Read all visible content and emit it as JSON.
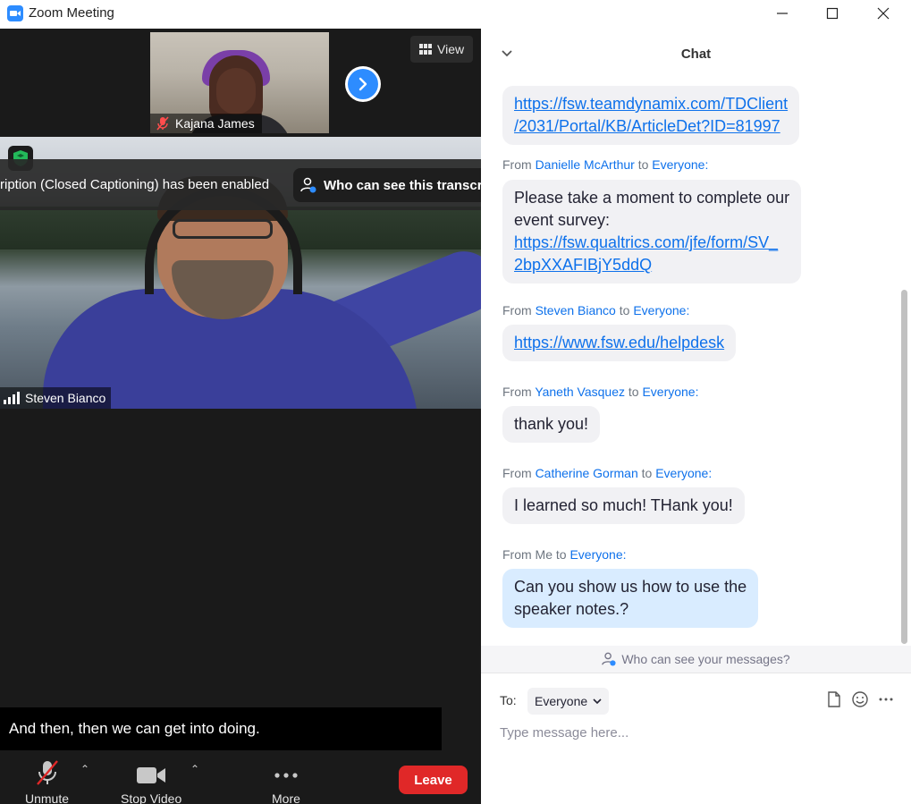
{
  "window": {
    "title": "Zoom Meeting",
    "controls": [
      "minimize-icon",
      "maximize-icon",
      "close-icon"
    ]
  },
  "gallery": {
    "view_label": "View",
    "thumbnail_name": "Kajana James",
    "main_speaker_name": "Steven Bianco"
  },
  "caption_notice": {
    "message": "ription (Closed Captioning) has been enabled",
    "who_can_see": "Who can see this transcript?",
    "close": "✕"
  },
  "live_caption": "And then, then we can get into doing.",
  "toolbar": {
    "unmute": "Unmute",
    "stop_video": "Stop Video",
    "more": "More",
    "leave": "Leave"
  },
  "chat": {
    "title": "Chat",
    "messages": [
      {
        "from_prefix": "",
        "from": "",
        "to_prefix": "",
        "to": "",
        "lines": [
          "https://fsw.teamdynamix.com/TDClient",
          "/2031/Portal/KB/ArticleDet?ID=81997"
        ]
      },
      {
        "from_prefix": "From",
        "from": "Danielle McArthur",
        "to_prefix": "to",
        "to": "Everyone:",
        "text_lines": [
          "Please take a moment to complete our",
          "event survey:"
        ],
        "link_lines": [
          "https://fsw.qualtrics.com/jfe/form/SV_",
          "2bpXXAFIBjY5ddQ"
        ]
      },
      {
        "from_prefix": "From",
        "from": "Steven Bianco",
        "to_prefix": "to",
        "to": "Everyone:",
        "link": "https://www.fsw.edu/helpdesk"
      },
      {
        "from_prefix": "From",
        "from": "Yaneth Vasquez",
        "to_prefix": "to",
        "to": "Everyone:",
        "text": "thank you!"
      },
      {
        "from_prefix": "From",
        "from": "Catherine Gorman",
        "to_prefix": "to",
        "to": "Everyone:",
        "text": "I learned so much! THank you!"
      },
      {
        "from_prefix": "From Me",
        "from": "",
        "to_prefix": "to",
        "to": "Everyone:",
        "text_lines": [
          "Can you show us how to use the",
          "speaker notes.?"
        ]
      }
    ],
    "who_can_see": "Who can see your messages?",
    "to_label": "To:",
    "recipient": "Everyone",
    "input_placeholder": "Type message here..."
  },
  "colors": {
    "accent": "#0e71eb",
    "leave": "#e02828",
    "self_bubble": "#d9ecff",
    "bubble": "#f1f1f4"
  }
}
